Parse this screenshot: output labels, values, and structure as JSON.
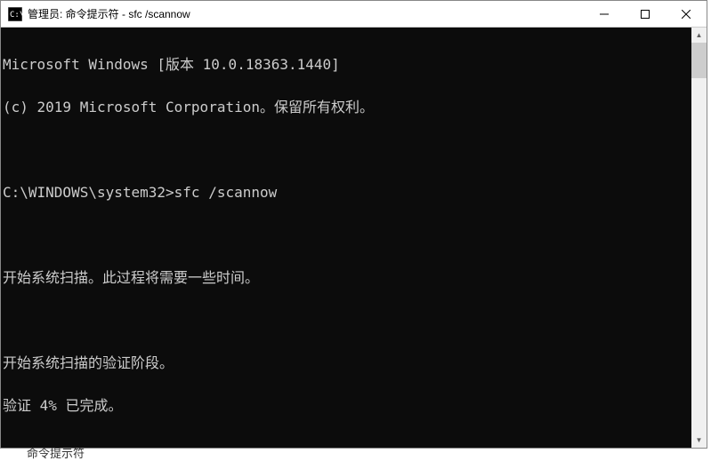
{
  "title": "管理员: 命令提示符 - sfc  /scannow",
  "terminal": {
    "lines": [
      "Microsoft Windows [版本 10.0.18363.1440]",
      "(c) 2019 Microsoft Corporation。保留所有权利。",
      "",
      "C:\\WINDOWS\\system32>sfc /scannow",
      "",
      "开始系统扫描。此过程将需要一些时间。",
      "",
      "开始系统扫描的验证阶段。",
      "验证 4% 已完成。"
    ]
  },
  "bottom_text": "命令提示符"
}
